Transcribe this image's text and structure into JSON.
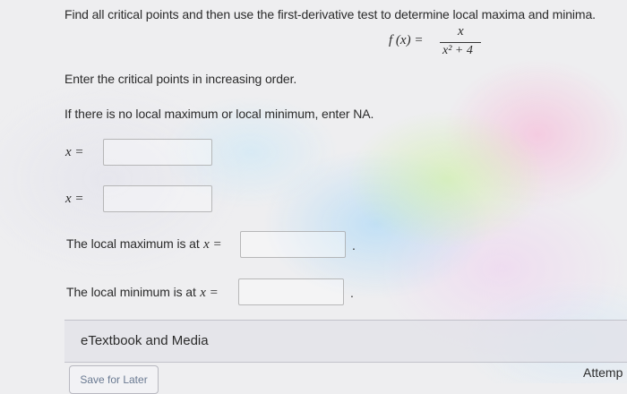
{
  "question": {
    "prompt": "Find all critical points and then use the first-derivative test to determine local maxima and minima.",
    "function": {
      "lhs": "f (x) =",
      "numerator": "x",
      "denominator": "x² + 4"
    },
    "instruction_order": "Enter the critical points in increasing order.",
    "instruction_na": "If there is no local maximum or local minimum, enter NA.",
    "critical_points": [
      {
        "label": "x =",
        "value": ""
      },
      {
        "label": "x =",
        "value": ""
      }
    ],
    "local_max": {
      "label_text": "The local maximum is at",
      "var": "x =",
      "value": "",
      "period": "."
    },
    "local_min": {
      "label_text": "The local minimum is at",
      "var": "x =",
      "value": "",
      "period": "."
    }
  },
  "resources": {
    "etextbook_label": "eTextbook and Media"
  },
  "footer": {
    "save_label": "Save for Later",
    "attempts_label": "Attemp"
  }
}
